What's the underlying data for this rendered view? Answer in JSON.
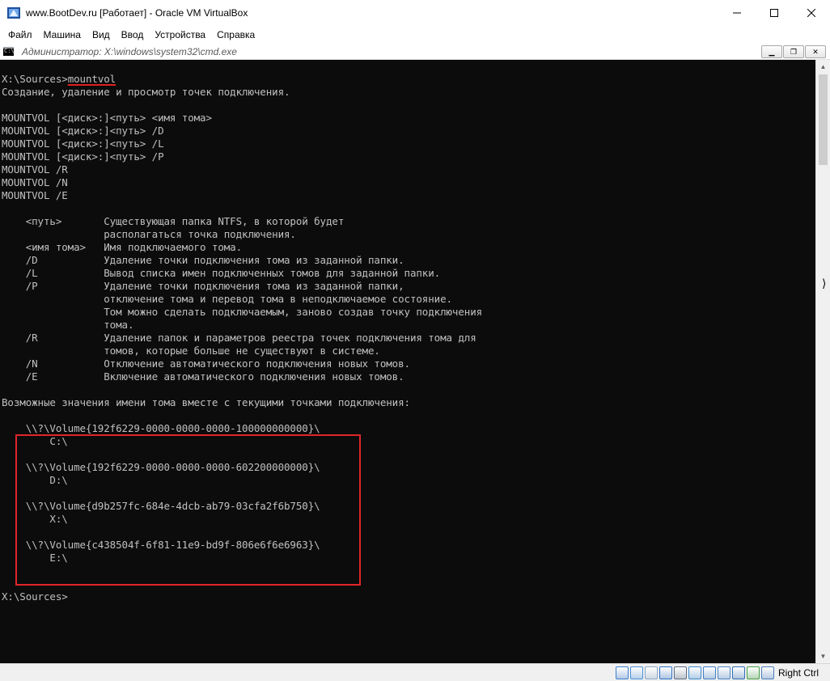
{
  "window": {
    "title": "www.BootDev.ru [Работает] - Oracle VM VirtualBox",
    "minimize": "—",
    "maximize": "☐",
    "close": "✕"
  },
  "menu": [
    "Файл",
    "Машина",
    "Вид",
    "Ввод",
    "Устройства",
    "Справка"
  ],
  "cmd_window": {
    "icon_text": "C:\\",
    "title": "Администратор: X:\\windows\\system32\\cmd.exe",
    "minimize": "▁",
    "maximize": "❐",
    "close": "✕"
  },
  "console": {
    "prompt_prefix": "X:\\Sources>",
    "command": "mountvol",
    "lines": [
      "Создание, удаление и просмотр точек подключения.",
      "",
      "MOUNTVOL [<диск>:]<путь> <имя тома>",
      "MOUNTVOL [<диск>:]<путь> /D",
      "MOUNTVOL [<диск>:]<путь> /L",
      "MOUNTVOL [<диск>:]<путь> /P",
      "MOUNTVOL /R",
      "MOUNTVOL /N",
      "MOUNTVOL /E",
      "",
      "    <путь>       Существующая папка NTFS, в которой будет",
      "                 располагаться точка подключения.",
      "    <имя тома>   Имя подключаемого тома.",
      "    /D           Удаление точки подключения тома из заданной папки.",
      "    /L           Вывод списка имен подключенных томов для заданной папки.",
      "    /P           Удаление точки подключения тома из заданной папки,",
      "                 отключение тома и перевод тома в неподключаемое состояние.",
      "                 Том можно сделать подключаемым, заново создав точку подключения",
      "                 тома.",
      "    /R           Удаление папок и параметров реестра точек подключения тома для",
      "                 томов, которые больше не существуют в системе.",
      "    /N           Отключение автоматического подключения новых томов.",
      "    /E           Включение автоматического подключения новых томов.",
      "",
      "Возможные значения имени тома вместе с текущими точками подключения:",
      "",
      "    \\\\?\\Volume{192f6229-0000-0000-0000-100000000000}\\",
      "        C:\\",
      "",
      "    \\\\?\\Volume{192f6229-0000-0000-0000-602200000000}\\",
      "        D:\\",
      "",
      "    \\\\?\\Volume{d9b257fc-684e-4dcb-ab79-03cfa2f6b750}\\",
      "        X:\\",
      "",
      "    \\\\?\\Volume{c438504f-6f81-11e9-bd9f-806e6f6e6963}\\",
      "        E:\\",
      "",
      "",
      "X:\\Sources>"
    ]
  },
  "statusbar": {
    "icons": [
      "hard-disk-icon",
      "optical-drive-icon",
      "audio-icon",
      "network-icon",
      "usb-icon",
      "shared-folders-icon",
      "display-icon",
      "video-capture-icon",
      "cpu-icon",
      "mouse-integration-icon",
      "keyboard-icon"
    ],
    "host_key": "Right Ctrl"
  },
  "colors": {
    "console_bg": "#0c0c0c",
    "console_fg": "#c0c0c0",
    "highlight": "#e0262a"
  }
}
